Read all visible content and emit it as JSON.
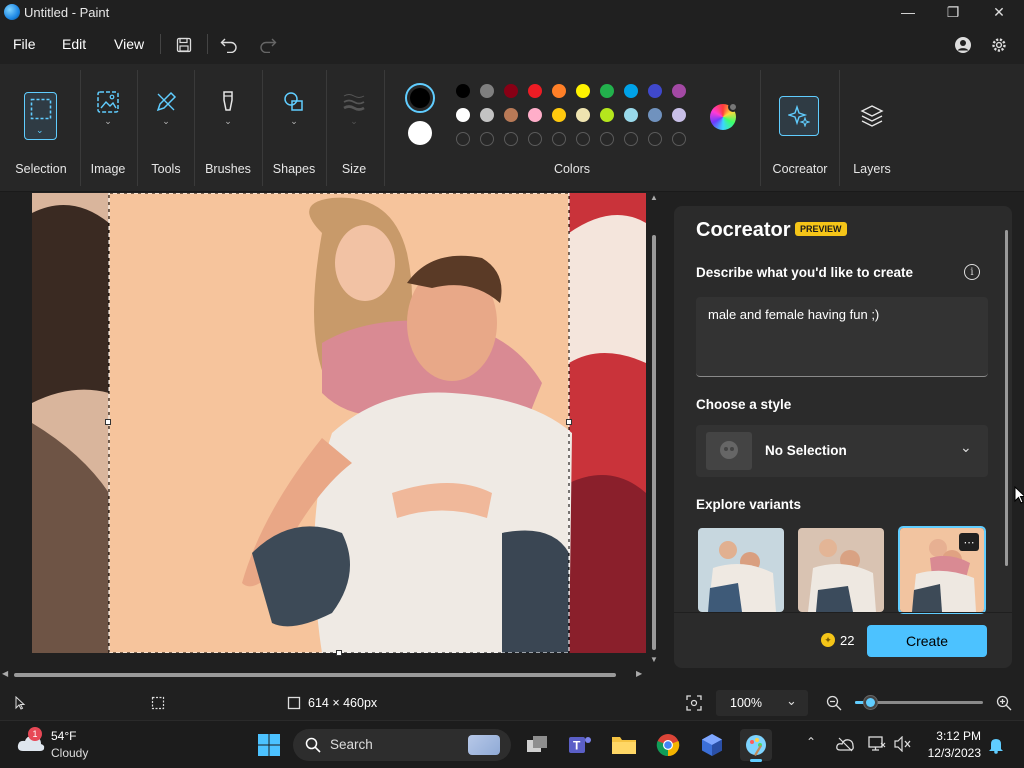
{
  "window": {
    "title": "Untitled - Paint",
    "minimize": "—",
    "maximize": "❐",
    "close": "✕"
  },
  "menu": {
    "file": "File",
    "edit": "Edit",
    "view": "View"
  },
  "ribbon": {
    "groups": {
      "selection": "Selection",
      "image": "Image",
      "tools": "Tools",
      "brushes": "Brushes",
      "shapes": "Shapes",
      "size": "Size",
      "colors": "Colors",
      "cocreator": "Cocreator",
      "layers": "Layers"
    },
    "primary_color": "#000000",
    "secondary_color": "#ffffff",
    "palette_row1": [
      "#000000",
      "#7f7f7f",
      "#880015",
      "#ed1c24",
      "#ff7f27",
      "#fff200",
      "#22b14c",
      "#00a2e8",
      "#3f48cc",
      "#a349a4"
    ],
    "palette_row2": [
      "#ffffff",
      "#c3c3c3",
      "#b97a57",
      "#ffaec9",
      "#ffc90e",
      "#efe4b0",
      "#b5e61d",
      "#99d9ea",
      "#7092be",
      "#c8bfe7"
    ]
  },
  "cocreator": {
    "title": "Cocreator",
    "badge": "PREVIEW",
    "describe_label": "Describe what you'd like to create",
    "prompt_value": "male and female having fun ;)",
    "style_label": "Choose a style",
    "style_value": "No Selection",
    "variants_label": "Explore variants",
    "credits": "22",
    "create_button": "Create"
  },
  "status": {
    "canvas_size": "614 × 460px",
    "zoom": "100%",
    "zoom_level": 0.12
  },
  "taskbar": {
    "weather_temp": "54°F",
    "weather_desc": "Cloudy",
    "weather_badge": "1",
    "search_placeholder": "Search",
    "time": "3:12 PM",
    "date": "12/3/2023"
  },
  "colors": {
    "accent": "#60cdff",
    "panel": "#2b2b2b",
    "create_button": "#4cc2ff"
  }
}
